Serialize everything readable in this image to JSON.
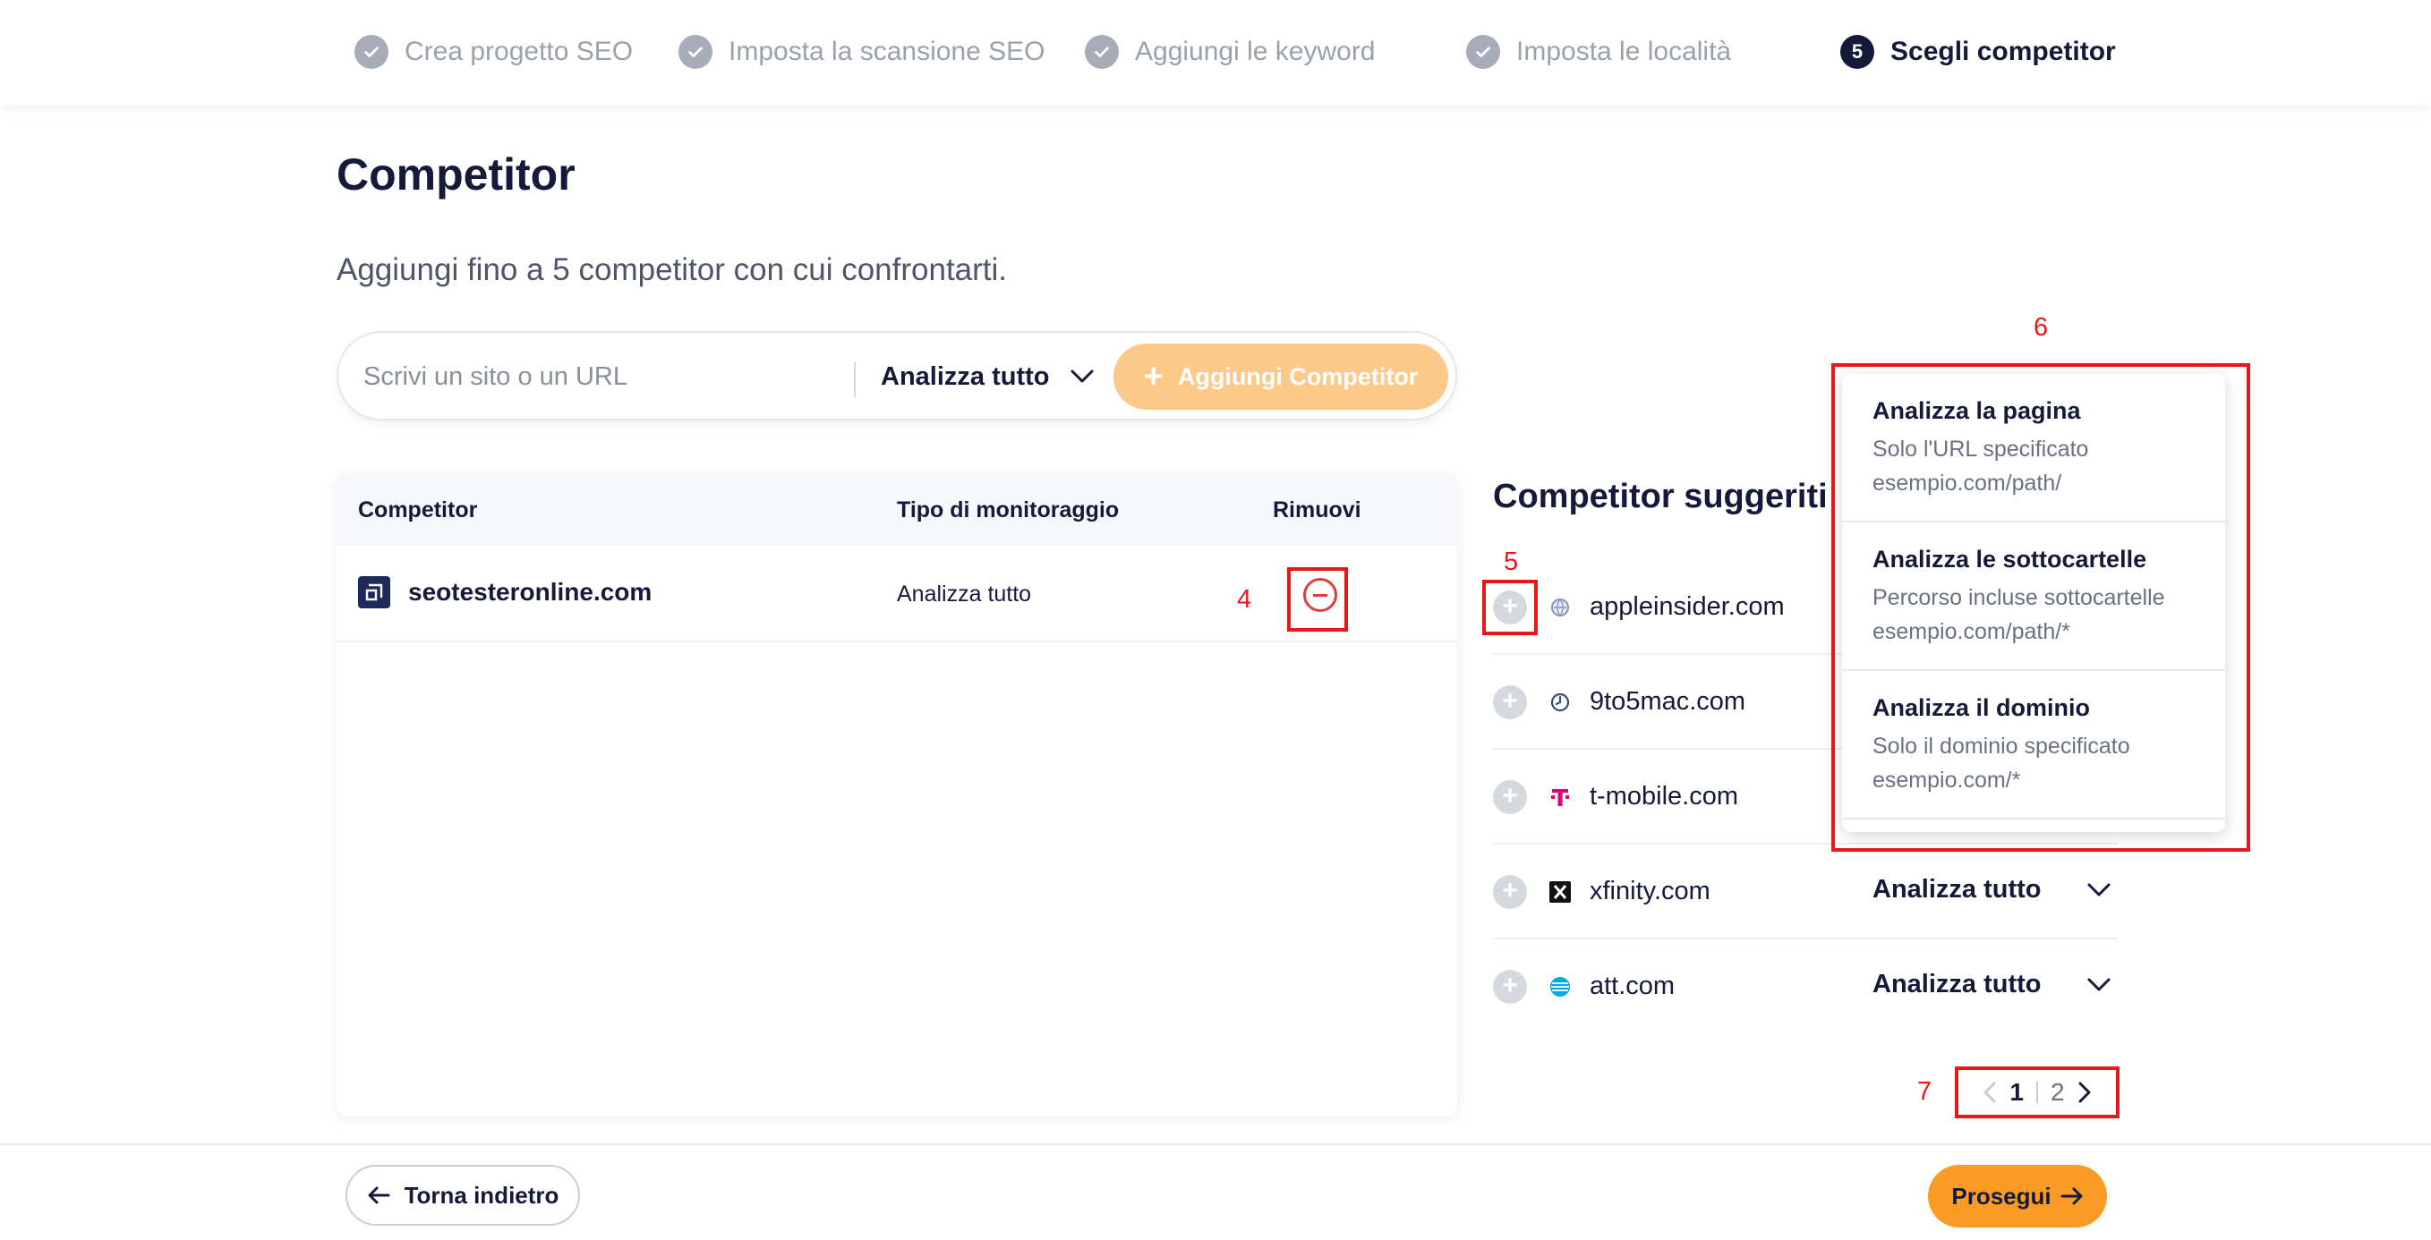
{
  "stepper": {
    "steps": [
      {
        "label": "Crea progetto SEO",
        "state": "done"
      },
      {
        "label": "Imposta la scansione SEO",
        "state": "done"
      },
      {
        "label": "Aggiungi le keyword",
        "state": "done"
      },
      {
        "label": "Imposta le località",
        "state": "done"
      },
      {
        "label": "Scegli competitor",
        "state": "active",
        "number": "5"
      }
    ]
  },
  "page": {
    "title": "Competitor",
    "subtitle": "Aggiungi fino a 5 competitor con cui confrontarti."
  },
  "search": {
    "placeholder": "Scrivi un sito o un URL",
    "value": "",
    "mode_label": "Analizza tutto",
    "add_button_label": "Aggiungi Competitor"
  },
  "table": {
    "headers": {
      "competitor": "Competitor",
      "type": "Tipo di monitoraggio",
      "remove": "Rimuovi"
    },
    "rows": [
      {
        "domain": "seotesteronline.com",
        "type": "Analizza tutto"
      }
    ]
  },
  "suggested": {
    "title": "Competitor suggeriti",
    "items": [
      {
        "domain": "appleinsider.com",
        "mode": ""
      },
      {
        "domain": "9to5mac.com",
        "mode": ""
      },
      {
        "domain": "t-mobile.com",
        "mode": ""
      },
      {
        "domain": "xfinity.com",
        "mode": "Analizza tutto"
      },
      {
        "domain": "att.com",
        "mode": "Analizza tutto"
      }
    ]
  },
  "dropdown": {
    "options": [
      {
        "title": "Analizza la pagina",
        "desc": "Solo l'URL specificato",
        "example": "esempio.com/path/"
      },
      {
        "title": "Analizza le sottocartelle",
        "desc": "Percorso incluse sottocartelle",
        "example": "esempio.com/path/*"
      },
      {
        "title": "Analizza il dominio",
        "desc": "Solo il dominio specificato",
        "example": "esempio.com/*"
      }
    ]
  },
  "pagination": {
    "current": "1",
    "next": "2"
  },
  "annotations": {
    "a4": "4",
    "a5": "5",
    "a6": "6",
    "a7": "7"
  },
  "footer": {
    "back_label": "Torna indietro",
    "next_label": "Prosegui"
  },
  "colors": {
    "accent_orange": "#f99b25",
    "accent_orange_light": "#fdc98a",
    "navy": "#161a3a",
    "annotation_red": "#e5191a"
  }
}
